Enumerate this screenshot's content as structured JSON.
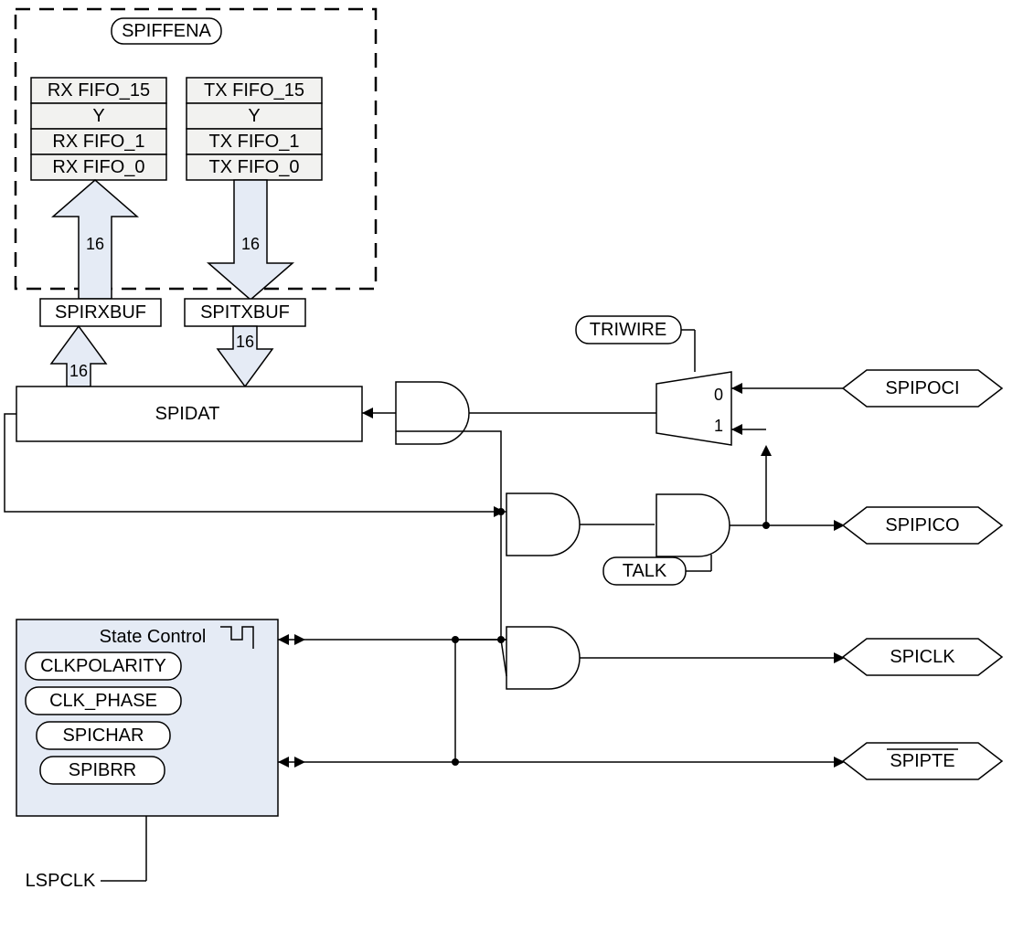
{
  "bus_width": "16",
  "labels": {
    "spiffena": "SPIFFENA",
    "rx15": "RX FIFO_15",
    "rxY": "Y",
    "rx1": "RX FIFO_1",
    "rx0": "RX FIFO_0",
    "tx15": "TX FIFO_15",
    "txY": "Y",
    "tx1": "TX FIFO_1",
    "tx0": "TX FIFO_0",
    "spirxbuf": "SPIRXBUF",
    "spitxbuf": "SPITXBUF",
    "spidat": "SPIDAT",
    "triwire": "TRIWIRE",
    "talk": "TALK",
    "mux0": "0",
    "mux1": "1",
    "statecontrol": "State Control",
    "clkpolarity": "CLKPOLARITY",
    "clkphase": "CLK_PHASE",
    "spichar": "SPICHAR",
    "spibrr": "SPIBRR",
    "lspclk": "LSPCLK",
    "spipoci": "SPIPOCI",
    "spipico": "SPIPICO",
    "spiclk": "SPICLK",
    "spipte": "SPIPTE"
  }
}
